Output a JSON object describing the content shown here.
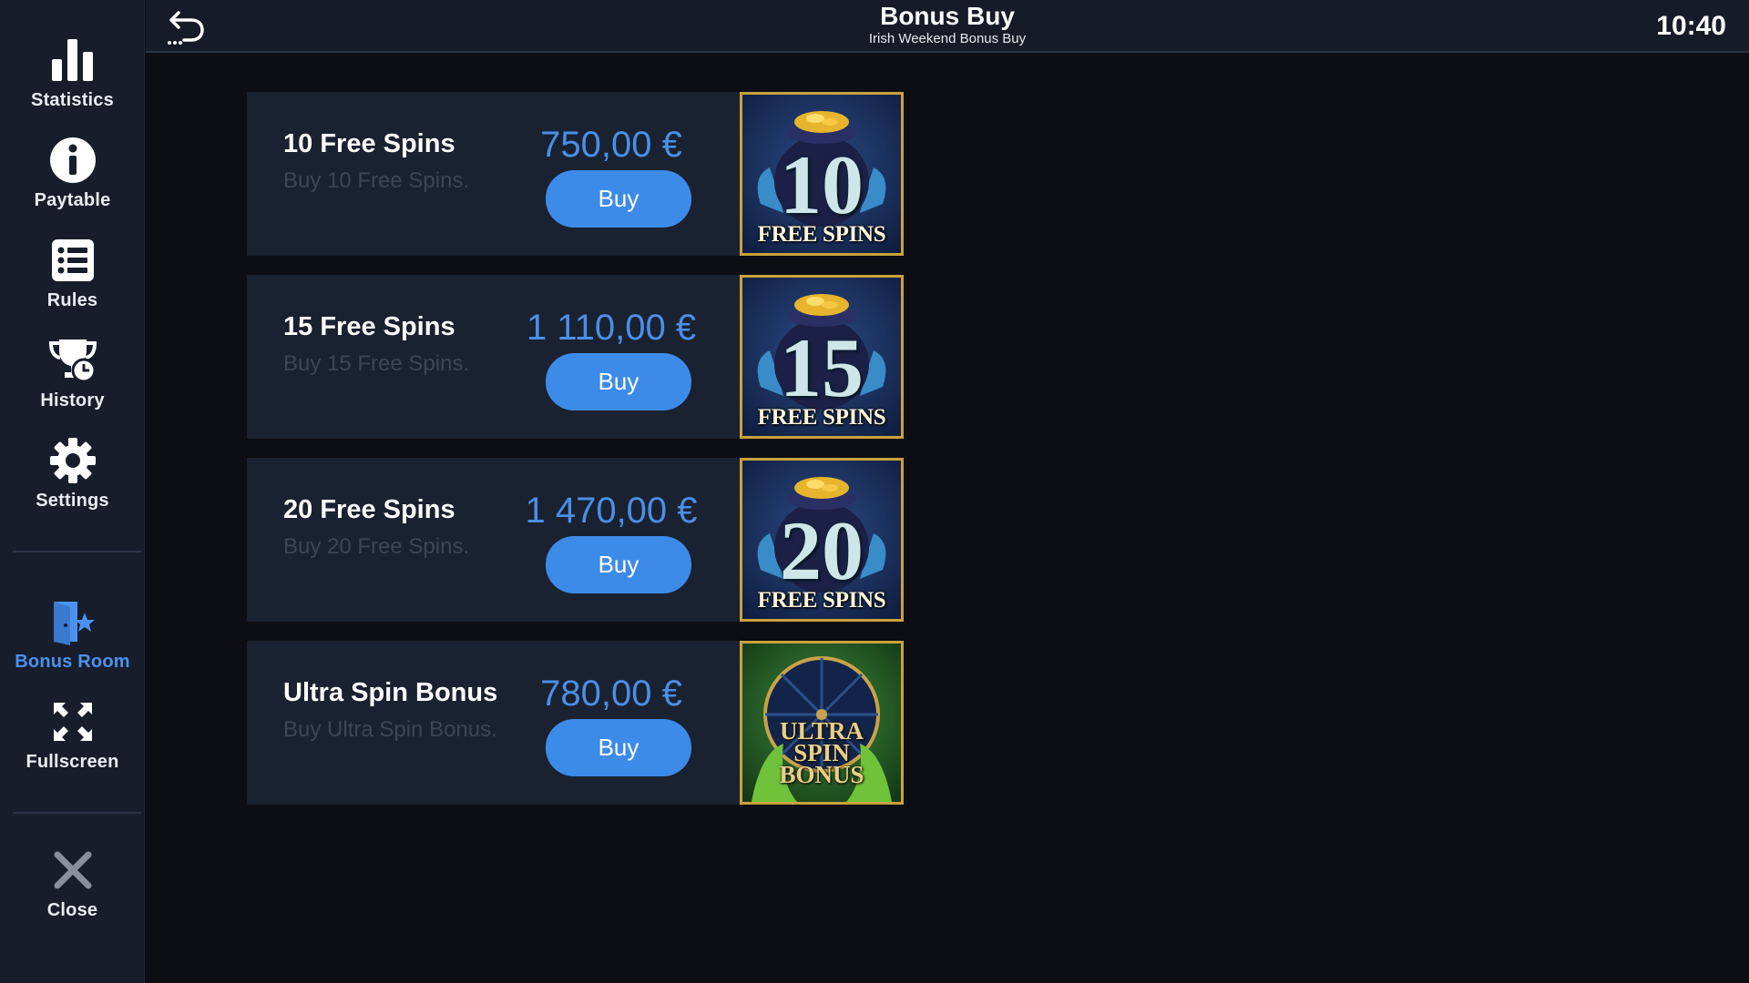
{
  "sidebar": {
    "items": [
      {
        "label": "Statistics",
        "icon": "bar-chart-icon"
      },
      {
        "label": "Paytable",
        "icon": "info-icon"
      },
      {
        "label": "Rules",
        "icon": "list-icon"
      },
      {
        "label": "History",
        "icon": "trophy-clock-icon"
      },
      {
        "label": "Settings",
        "icon": "gear-icon"
      },
      {
        "label": "Bonus Room",
        "icon": "door-star-icon",
        "active": true
      },
      {
        "label": "Fullscreen",
        "icon": "fullscreen-icon"
      },
      {
        "label": "Close",
        "icon": "close-icon"
      }
    ]
  },
  "header": {
    "title": "Bonus Buy",
    "subtitle": "Irish Weekend Bonus Buy",
    "clock": "10:40"
  },
  "offers": [
    {
      "title": "10 Free Spins",
      "description": "Buy 10 Free Spins.",
      "price": "750,00 €",
      "button": "Buy",
      "thumb_number": "10",
      "thumb_label": "FREE SPINS"
    },
    {
      "title": "15 Free Spins",
      "description": "Buy 15 Free Spins.",
      "price": "1 110,00 €",
      "button": "Buy",
      "thumb_number": "15",
      "thumb_label": "FREE SPINS"
    },
    {
      "title": "20 Free Spins",
      "description": "Buy 20 Free Spins.",
      "price": "1 470,00 €",
      "button": "Buy",
      "thumb_number": "20",
      "thumb_label": "FREE SPINS"
    },
    {
      "title": "Ultra Spin Bonus",
      "description": "Buy Ultra Spin Bonus.",
      "price": "780,00 €",
      "button": "Buy",
      "thumb_line1": "ULTRA",
      "thumb_line2": "SPIN",
      "thumb_line3": "BONUS"
    }
  ],
  "colors": {
    "accent": "#3d8be8",
    "price": "#4a8fe8",
    "active_nav": "#4b92ee",
    "background": "#0c0e14",
    "panel": "#1a2130"
  }
}
